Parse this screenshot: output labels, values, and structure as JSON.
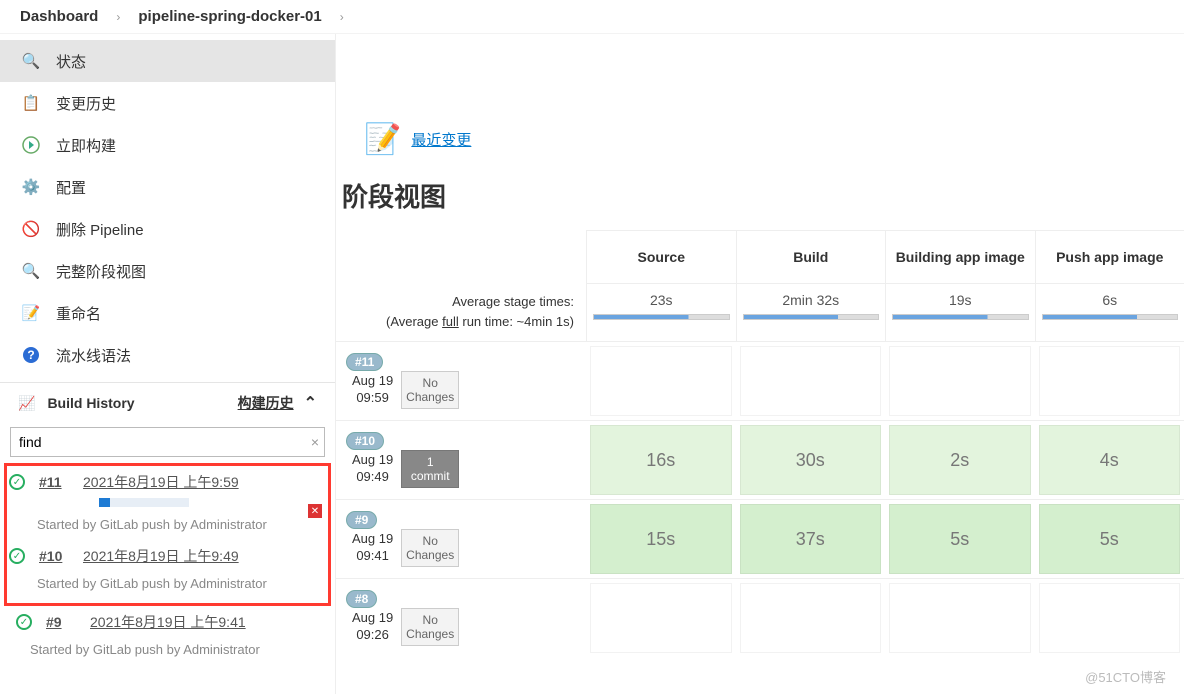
{
  "breadcrumb": {
    "root": "Dashboard",
    "project": "pipeline-spring-docker-01"
  },
  "menu": [
    {
      "label": "状态",
      "icon": "search-icon",
      "active": true
    },
    {
      "label": "变更历史",
      "icon": "doc-icon"
    },
    {
      "label": "立即构建",
      "icon": "play-icon"
    },
    {
      "label": "配置",
      "icon": "gear-icon"
    },
    {
      "label": "删除 Pipeline",
      "icon": "forbidden-icon"
    },
    {
      "label": "完整阶段视图",
      "icon": "search-icon"
    },
    {
      "label": "重命名",
      "icon": "rename-icon"
    },
    {
      "label": "流水线语法",
      "icon": "help-icon"
    }
  ],
  "build_history": {
    "title": "Build History",
    "link": "构建历史",
    "find_value": "find",
    "items": [
      {
        "num": "#11",
        "ts": "2021年8月19日 上午9:59",
        "desc": "Started by GitLab push by Administrator",
        "running": true
      },
      {
        "num": "#10",
        "ts": "2021年8月19日 上午9:49",
        "desc": "Started by GitLab push by Administrator"
      },
      {
        "num": "#9",
        "ts": "2021年8月19日 上午9:41",
        "desc": "Started by GitLab push by Administrator"
      }
    ]
  },
  "recent_changes": "最近变更",
  "stage_view_title": "阶段视图",
  "avg_label1": "Average stage times:",
  "avg_label2_pre": "(Average ",
  "avg_label2_mid": "full",
  "avg_label2_post": " run time: ~4min 1s)",
  "stages": [
    "Source",
    "Build",
    "Building app image",
    "Push app image"
  ],
  "avg_times": [
    "23s",
    "2min 32s",
    "19s",
    "6s"
  ],
  "chart_data": {
    "type": "table",
    "title": "阶段视图",
    "columns": [
      "Source",
      "Build",
      "Building app image",
      "Push app image"
    ],
    "average_stage_times": [
      "23s",
      "2min 32s",
      "19s",
      "6s"
    ],
    "average_full_run_time": "~4min 1s",
    "rows": [
      {
        "build": "#11",
        "date": "Aug 19",
        "time": "09:59",
        "changes": "No Changes",
        "commit_count": null,
        "cells": [
          "",
          "",
          "",
          ""
        ]
      },
      {
        "build": "#10",
        "date": "Aug 19",
        "time": "09:49",
        "changes": null,
        "commit_count": "1 commit",
        "cells": [
          "16s",
          "30s",
          "2s",
          "4s"
        ]
      },
      {
        "build": "#9",
        "date": "Aug 19",
        "time": "09:41",
        "changes": "No Changes",
        "commit_count": null,
        "cells": [
          "15s",
          "37s",
          "5s",
          "5s"
        ]
      },
      {
        "build": "#8",
        "date": "Aug 19",
        "time": "09:26",
        "changes": "No Changes",
        "commit_count": null,
        "cells": [
          "",
          "",
          "",
          ""
        ]
      }
    ]
  },
  "watermark": "@51CTO博客"
}
